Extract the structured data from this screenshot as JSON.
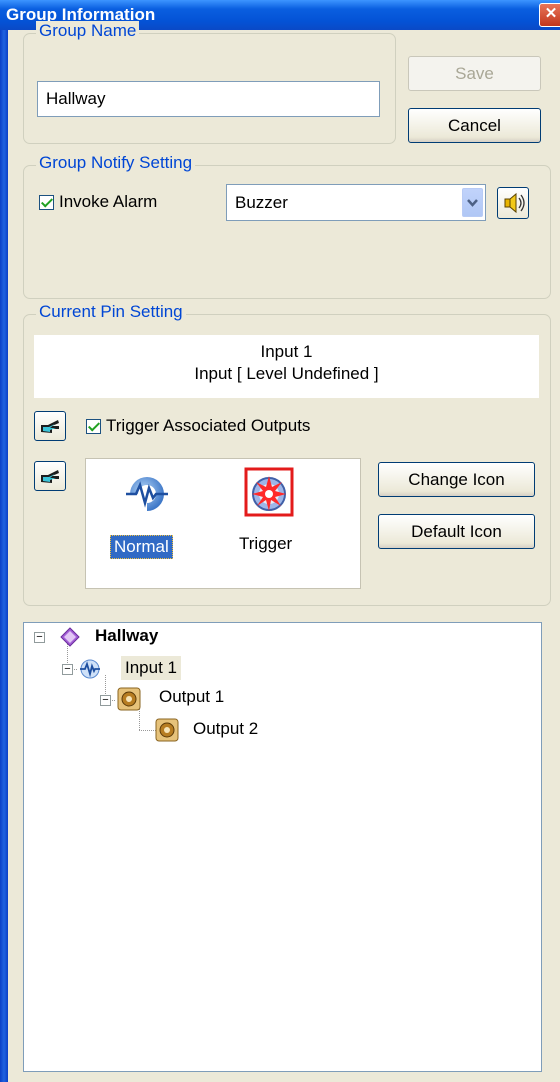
{
  "window": {
    "title": "Group Information",
    "close_glyph": "✕"
  },
  "group_name": {
    "legend": "Group Name",
    "value": "Hallway",
    "save_label": "Save",
    "cancel_label": "Cancel"
  },
  "notify": {
    "legend": "Group Notify Setting",
    "invoke_alarm_label": "Invoke Alarm",
    "invoke_alarm_checked": true,
    "alarm_selected": "Buzzer",
    "speaker_icon": "speaker-icon"
  },
  "pin": {
    "legend": "Current Pin Setting",
    "name": "Input 1",
    "type": "Input [ Level Undefined ]",
    "trigger_outputs_label": "Trigger Associated Outputs",
    "trigger_outputs_checked": true,
    "icons": [
      {
        "label": "Normal",
        "icon": "input-wave-icon",
        "selected": true
      },
      {
        "label": "Trigger",
        "icon": "trigger-burst-icon",
        "selected": false
      }
    ],
    "change_icon_label": "Change Icon",
    "default_icon_label": "Default Icon"
  },
  "tree": {
    "root": {
      "label": "Hallway",
      "icon": "group-diamond-icon"
    },
    "nodes": [
      {
        "label": "Input 1",
        "icon": "input-wave-icon",
        "highlighted": true
      },
      {
        "label": "Output 1",
        "icon": "output-speaker-icon"
      },
      {
        "label": "Output 2",
        "icon": "output-speaker-icon"
      }
    ]
  },
  "colors": {
    "accent": "#0046d5",
    "titlebar": "#0453d6",
    "selection": "#316ac5"
  }
}
